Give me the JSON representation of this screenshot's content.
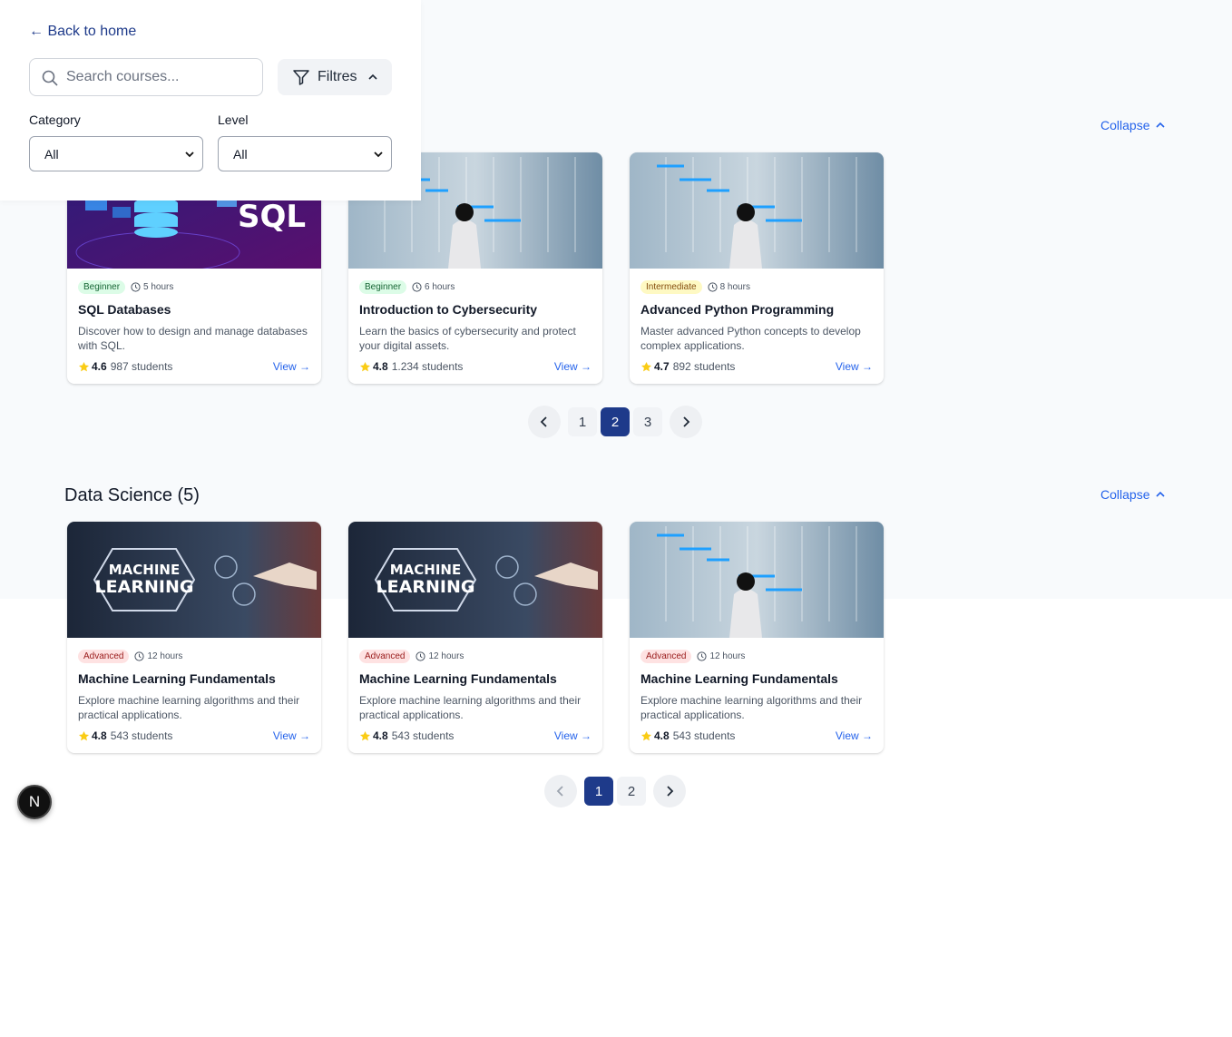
{
  "filters": {
    "back_label": "← Back to home",
    "search_placeholder": "Search courses...",
    "filter_button_label": "Filtres",
    "category_label": "Category",
    "category_value": "All",
    "level_label": "Level",
    "level_value": "All"
  },
  "sections": [
    {
      "title": "",
      "collapse_label": "Collapse",
      "courses": [
        {
          "level": "Beginner",
          "duration": "5 hours",
          "title": "SQL Databases",
          "description": "Discover how to design and manage databases with SQL.",
          "rating": "4.6",
          "students": "987 students",
          "view_label": "View →",
          "image": "sql-image"
        },
        {
          "level": "Beginner",
          "duration": "6 hours",
          "title": "Introduction to Cybersecurity",
          "description": "Learn the basics of cybersecurity and protect your digital assets.",
          "rating": "4.8",
          "students": "1.234 students",
          "view_label": "View →",
          "image": "chart-image"
        },
        {
          "level": "Intermediate",
          "duration": "8 hours",
          "title": "Advanced Python Programming",
          "description": "Master advanced Python concepts to develop complex applications.",
          "rating": "4.7",
          "students": "892 students",
          "view_label": "View →",
          "image": "chart-image"
        }
      ],
      "pagination": {
        "pages": [
          "1",
          "2",
          "3"
        ],
        "current": "2"
      }
    },
    {
      "title": "Data Science (5)",
      "collapse_label": "Collapse",
      "courses": [
        {
          "level": "Advanced",
          "duration": "12 hours",
          "title": "Machine Learning Fundamentals",
          "description": "Explore machine learning algorithms and their practical applications.",
          "rating": "4.8",
          "students": "543 students",
          "view_label": "View →",
          "image": "ml-image"
        },
        {
          "level": "Advanced",
          "duration": "12 hours",
          "title": "Machine Learning Fundamentals",
          "description": "Explore machine learning algorithms and their practical applications.",
          "rating": "4.8",
          "students": "543 students",
          "view_label": "View →",
          "image": "ml-image"
        },
        {
          "level": "Advanced",
          "duration": "12 hours",
          "title": "Machine Learning Fundamentals",
          "description": "Explore machine learning algorithms and their practical applications.",
          "rating": "4.8",
          "students": "543 students",
          "view_label": "View →",
          "image": "chart-image"
        }
      ],
      "pagination": {
        "pages": [
          "1",
          "2"
        ],
        "current": "1"
      }
    }
  ],
  "dev_badge": {
    "label": "N"
  },
  "colors": {
    "accent": "#2563eb",
    "primary": "#1e3a8a",
    "star": "#facc15"
  }
}
